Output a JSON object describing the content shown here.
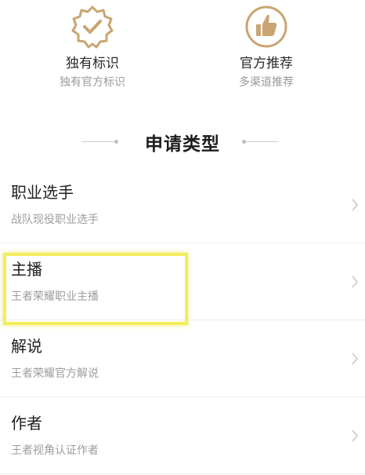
{
  "features": [
    {
      "icon": "verified-badge-icon",
      "title": "独有标识",
      "subtitle": "独有官方标识"
    },
    {
      "icon": "thumbs-up-icon",
      "title": "官方推荐",
      "subtitle": "多渠道推荐"
    }
  ],
  "section": {
    "title": "申请类型"
  },
  "types": [
    {
      "name": "职业选手",
      "desc": "战队现役职业选手"
    },
    {
      "name": "主播",
      "desc": "王者荣耀职业主播"
    },
    {
      "name": "解说",
      "desc": "王者荣耀官方解说"
    },
    {
      "name": "作者",
      "desc": "王者视角认证作者"
    }
  ],
  "colors": {
    "accent_gold": "#c9a572",
    "highlight": "#f2ee5e"
  }
}
